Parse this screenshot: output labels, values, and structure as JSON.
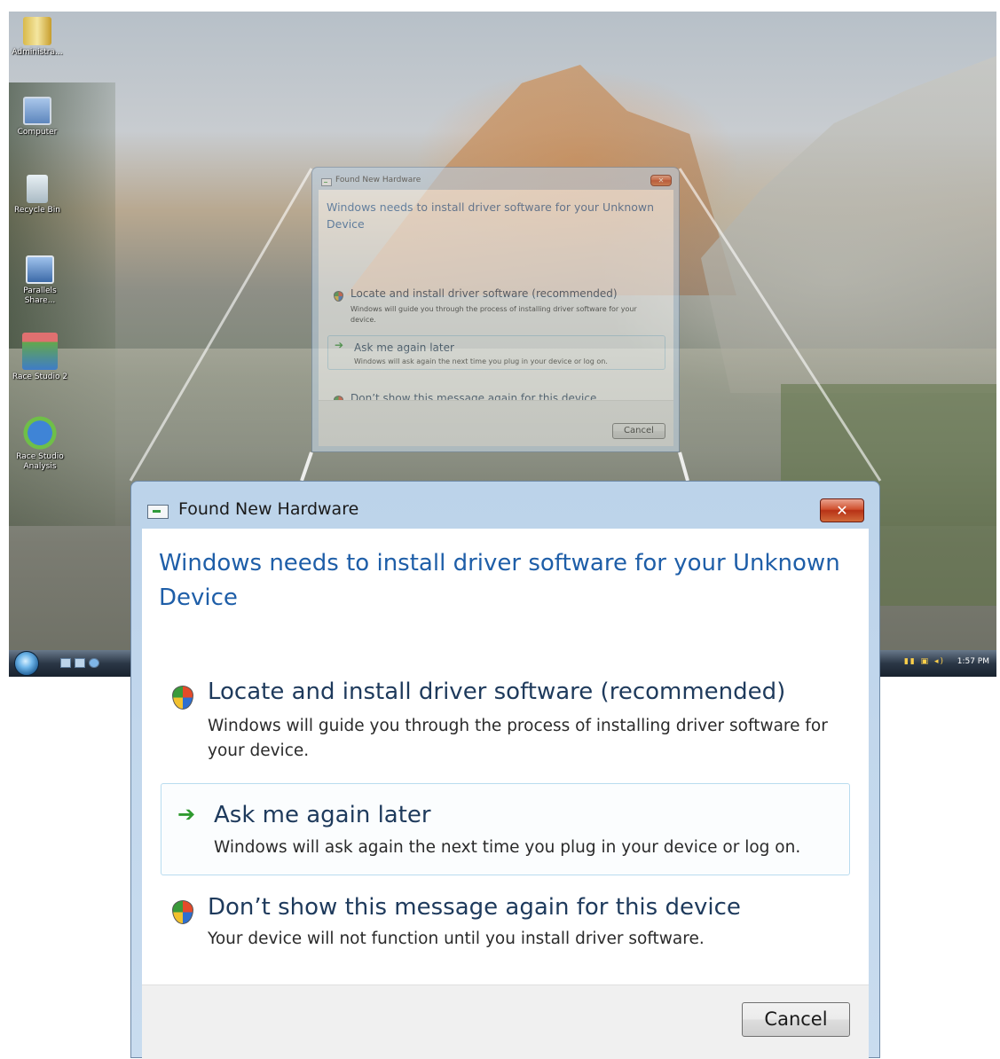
{
  "desktop": {
    "icons": [
      {
        "label": "Administra...",
        "glyph": "folder-icon"
      },
      {
        "label": "Computer",
        "glyph": "computer-icon"
      },
      {
        "label": "Recycle Bin",
        "glyph": "recycle-bin-icon"
      },
      {
        "label": "Parallels Share...",
        "glyph": "network-share-icon"
      },
      {
        "label": "Race Studio 2",
        "glyph": "aim-logo-icon"
      },
      {
        "label": "Race Studio Analysis",
        "glyph": "aim-globe-icon"
      }
    ],
    "taskbar": {
      "clock": "1:57 PM"
    }
  },
  "dialog": {
    "title": "Found New Hardware",
    "close_label": "✕",
    "heading": "Windows needs to install driver software for your Unknown Device",
    "options": [
      {
        "title": "Locate and install driver software (recommended)",
        "description": "Windows will guide you through the process of installing driver software for your device.",
        "icon": "shield-icon"
      },
      {
        "title": "Ask me again later",
        "description": "Windows will ask again the next time you plug in your device or log on.",
        "icon": "green-arrow-icon"
      },
      {
        "title": "Don’t show this message again for this device",
        "description": "Your device will not function until you install driver software.",
        "icon": "shield-icon"
      }
    ],
    "cancel_label": "Cancel"
  }
}
